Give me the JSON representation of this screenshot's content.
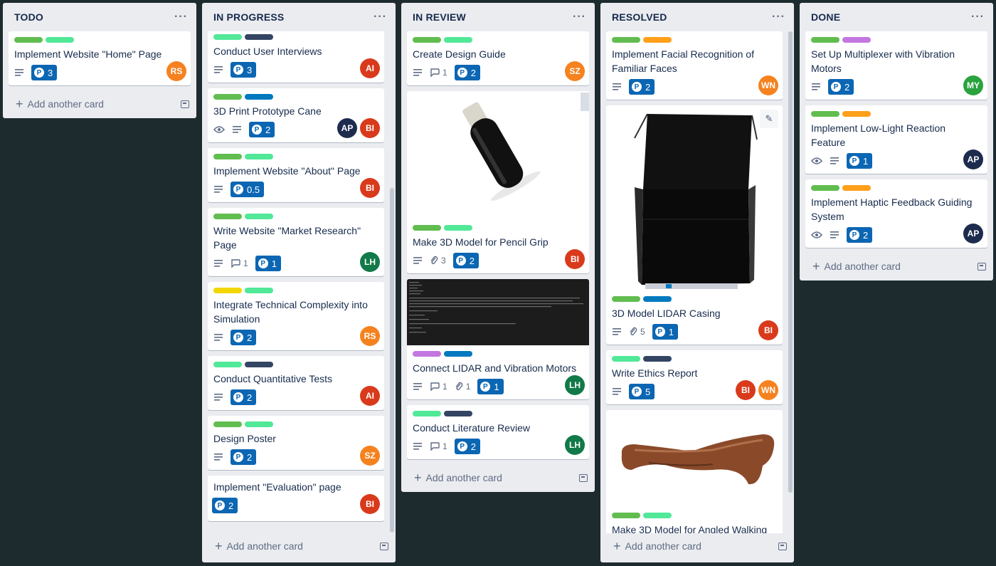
{
  "colors": {
    "green": "#61bd4f",
    "teal": "#51e898",
    "navy": "#344563",
    "blue": "#0079bf",
    "orange": "#ff9f1a",
    "yellow": "#f2d600",
    "purple": "#c377e0"
  },
  "add_card_label": "Add another card",
  "icons": {
    "description": "description-icon",
    "comment": "comment-icon",
    "attachment": "paperclip-icon",
    "watch": "eye-icon",
    "points": "story-points-icon",
    "menu": "ellipsis-icon",
    "add": "plus-icon",
    "template": "card-template-icon",
    "edit": "pencil-icon"
  },
  "lists": [
    {
      "title": "TODO",
      "menu": "···",
      "cards": [
        {
          "title": "Implement Website \"Home\" Page",
          "labels": [
            "green",
            "teal"
          ],
          "points": "3",
          "avatars": [
            {
              "initials": "RS",
              "color": "#f5821f"
            }
          ]
        }
      ]
    },
    {
      "title": "IN PROGRESS",
      "menu": "···",
      "cards": [
        {
          "title": "Conduct User Interviews",
          "labels": [
            "teal",
            "navy"
          ],
          "points": "3",
          "avatars": [
            {
              "initials": "AI",
              "color": "#d93a1b"
            }
          ]
        },
        {
          "title": "3D Print Prototype Cane",
          "labels": [
            "green",
            "blue"
          ],
          "points": "2",
          "watch": true,
          "avatars": [
            {
              "initials": "AP",
              "color": "#1d2b4e"
            },
            {
              "initials": "BI",
              "color": "#d93a1b"
            }
          ]
        },
        {
          "title": "Implement Website \"About\" Page",
          "labels": [
            "green",
            "teal"
          ],
          "points": "0.5",
          "avatars": [
            {
              "initials": "BI",
              "color": "#d93a1b"
            }
          ]
        },
        {
          "title": "Write Website \"Market Research\" Page",
          "labels": [
            "green",
            "teal"
          ],
          "points": "1",
          "comments": "1",
          "avatars": [
            {
              "initials": "LH",
              "color": "#117a48"
            }
          ]
        },
        {
          "title": "Integrate Technical Complexity into Simulation",
          "labels": [
            "yellow",
            "teal"
          ],
          "points": "2",
          "avatars": [
            {
              "initials": "RS",
              "color": "#f5821f"
            }
          ]
        },
        {
          "title": "Conduct Quantitative Tests",
          "labels": [
            "teal",
            "navy"
          ],
          "points": "2",
          "avatars": [
            {
              "initials": "AI",
              "color": "#d93a1b"
            }
          ]
        },
        {
          "title": "Design Poster",
          "labels": [
            "green",
            "teal"
          ],
          "points": "2",
          "avatars": [
            {
              "initials": "SZ",
              "color": "#f5821f"
            }
          ]
        },
        {
          "title": "Implement \"Evaluation\" page",
          "labels": [],
          "points": "2",
          "nodesc": true,
          "avatars": [
            {
              "initials": "BI",
              "color": "#d93a1b"
            }
          ]
        }
      ]
    },
    {
      "title": "IN REVIEW",
      "menu": "···",
      "cards": [
        {
          "title": "Create Design Guide",
          "labels": [
            "green",
            "teal"
          ],
          "points": "2",
          "comments": "1",
          "avatars": [
            {
              "initials": "SZ",
              "color": "#f5821f"
            }
          ]
        },
        {
          "title": "Make 3D Model for Pencil Grip",
          "labels": [
            "green",
            "teal"
          ],
          "points": "2",
          "attachments": "3",
          "cover": "grip",
          "avatars": [
            {
              "initials": "BI",
              "color": "#d93a1b"
            }
          ]
        },
        {
          "title": "Connect LIDAR and Vibration Motors",
          "labels": [
            "purple",
            "blue"
          ],
          "points": "1",
          "comments": "1",
          "attachments": "1",
          "cover": "terminal",
          "avatars": [
            {
              "initials": "LH",
              "color": "#117a48"
            }
          ]
        },
        {
          "title": "Conduct Literature Review",
          "labels": [
            "teal",
            "navy"
          ],
          "points": "2",
          "comments": "1",
          "avatars": [
            {
              "initials": "LH",
              "color": "#117a48"
            }
          ]
        }
      ]
    },
    {
      "title": "RESOLVED",
      "menu": "···",
      "cards": [
        {
          "title": "Implement Facial Recognition of Familiar Faces",
          "labels": [
            "green",
            "orange"
          ],
          "points": "2",
          "avatars": [
            {
              "initials": "WN",
              "color": "#f5821f"
            }
          ]
        },
        {
          "title": "3D Model LIDAR Casing",
          "labels": [
            "green",
            "blue"
          ],
          "points": "1",
          "attachments": "5",
          "cover": "casing",
          "avatars": [
            {
              "initials": "BI",
              "color": "#d93a1b"
            }
          ]
        },
        {
          "title": "Write Ethics Report",
          "labels": [
            "teal",
            "navy"
          ],
          "points": "5",
          "avatars": [
            {
              "initials": "BI",
              "color": "#d93a1b"
            },
            {
              "initials": "WN",
              "color": "#f5821f"
            }
          ]
        },
        {
          "title": "Make 3D Model for Angled Walking",
          "labels": [
            "green",
            "teal"
          ],
          "cover": "handle",
          "avatars": []
        }
      ]
    },
    {
      "title": "DONE",
      "menu": "···",
      "cards": [
        {
          "title": "Set Up Multiplexer with Vibration Motors",
          "labels": [
            "green",
            "purple"
          ],
          "points": "2",
          "avatars": [
            {
              "initials": "MY",
              "color": "#2aa33f"
            }
          ]
        },
        {
          "title": "Implement Low-Light Reaction Feature",
          "labels": [
            "green",
            "orange"
          ],
          "points": "1",
          "watch": true,
          "avatars": [
            {
              "initials": "AP",
              "color": "#1d2b4e"
            }
          ]
        },
        {
          "title": "Implement Haptic Feedback Guiding System",
          "labels": [
            "green",
            "orange"
          ],
          "points": "2",
          "watch": true,
          "avatars": [
            {
              "initials": "AP",
              "color": "#1d2b4e"
            }
          ]
        }
      ]
    }
  ]
}
